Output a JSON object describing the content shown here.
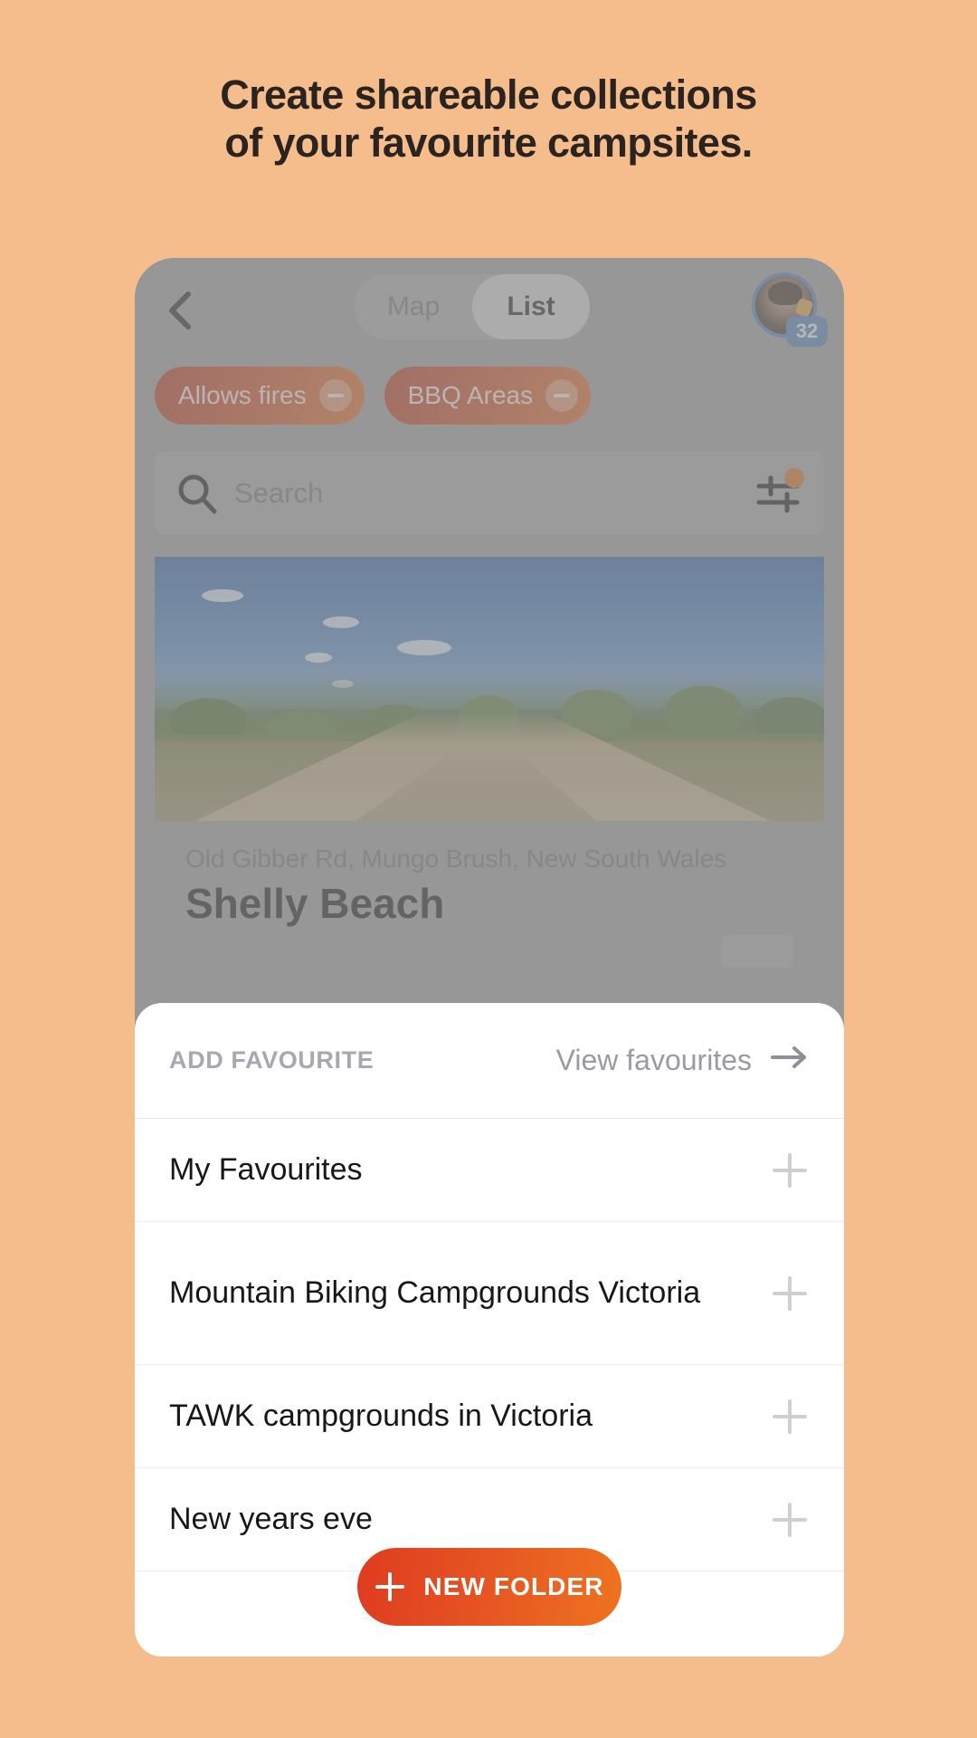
{
  "promo": {
    "line1": "Create shareable collections",
    "line2": "of your favourite campsites."
  },
  "colors": {
    "background": "#f4bd8b",
    "accent_red": "#df3c20",
    "accent_orange": "#ee7320",
    "badge_blue": "#4b7bb5",
    "sheet_bg": "#ffffff"
  },
  "app": {
    "header": {
      "back_icon": "chevron-left-icon",
      "segmented": {
        "options": [
          "Map",
          "List"
        ],
        "selected": "List"
      },
      "avatar": {
        "icon": "avatar",
        "badge_count": "32"
      }
    },
    "filter_chips": [
      {
        "label": "Allows fires",
        "remove_icon": "minus-circle-icon"
      },
      {
        "label": "BBQ Areas",
        "remove_icon": "minus-circle-icon"
      }
    ],
    "search": {
      "icon": "search-icon",
      "placeholder": "Search",
      "value": "",
      "filter_icon": "tune-sliders-icon",
      "filter_badge": true
    },
    "listing": {
      "image_alt": "dirt road through bushland",
      "address": "Old Gibber Rd, Mungo Brush, New South Wales",
      "name": "Shelly Beach"
    }
  },
  "sheet": {
    "header": {
      "title": "ADD FAVOURITE",
      "view_link": "View favourites",
      "view_link_icon": "arrow-right-icon"
    },
    "folders": [
      {
        "name": "My Favourites",
        "add_icon": "plus-icon"
      },
      {
        "name": "Mountain Biking Campgrounds Victoria",
        "add_icon": "plus-icon"
      },
      {
        "name": "TAWK campgrounds in Victoria",
        "add_icon": "plus-icon"
      },
      {
        "name": "New years eve",
        "add_icon": "plus-icon"
      }
    ],
    "new_folder_button": {
      "label": "NEW FOLDER",
      "icon": "plus-icon"
    }
  }
}
